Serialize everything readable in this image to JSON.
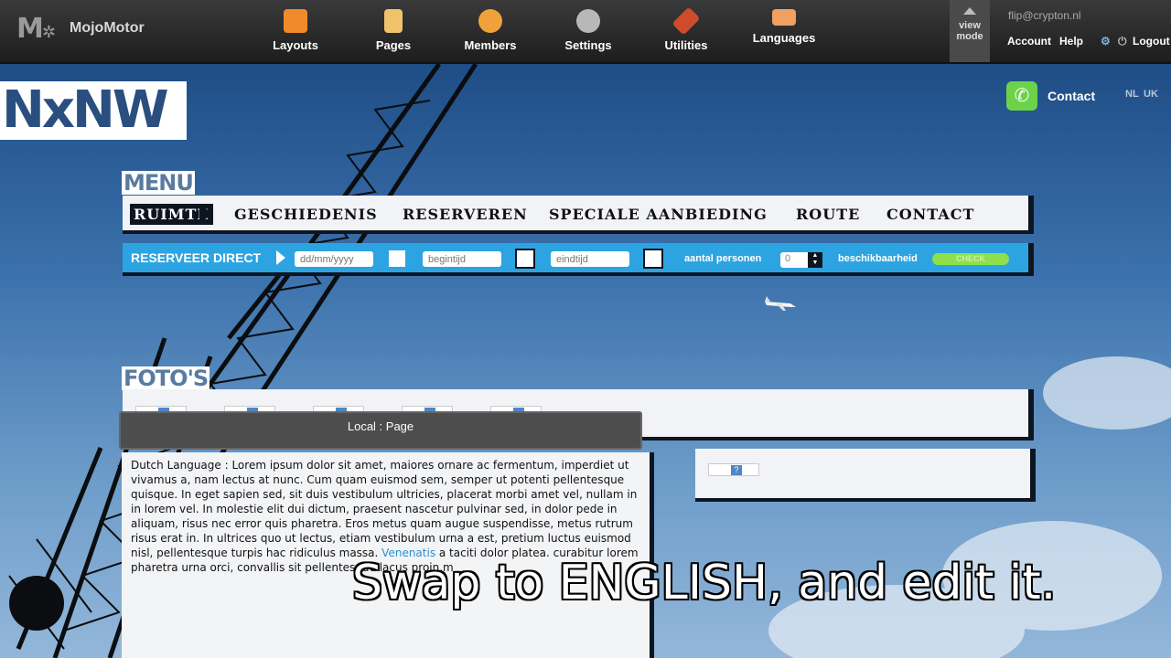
{
  "app": {
    "name": "MojoMotor"
  },
  "toolbar": {
    "nav": [
      {
        "label": "Layouts",
        "icon": "layouts-icon",
        "color": "#f08a2a"
      },
      {
        "label": "Pages",
        "icon": "pages-icon",
        "color": "#f0c36a"
      },
      {
        "label": "Members",
        "icon": "members-icon",
        "color": "#f0a23a"
      },
      {
        "label": "Settings",
        "icon": "settings-icon",
        "color": "#b8b8b8"
      },
      {
        "label": "Utilities",
        "icon": "utilities-icon",
        "color": "#d04b2a"
      },
      {
        "label": "Languages",
        "icon": "languages-icon",
        "color": "#f0a060"
      }
    ],
    "view_mode_line1": "view",
    "view_mode_line2": "mode",
    "user_email": "flip@crypton.nl",
    "account": "Account",
    "help": "Help",
    "logout": "Logout"
  },
  "site": {
    "logo_left": "NxNW",
    "contact": "Contact",
    "lang_nl": "NL",
    "lang_uk": "UK",
    "menu_heading": "MENU",
    "menu": [
      "RUIMTE",
      "GESCHIEDENIS",
      "RESERVEREN",
      "SPECIALE AANBIEDING",
      "ROUTE",
      "CONTACT"
    ],
    "reserve": {
      "title": "RESERVEER DIRECT",
      "date_placeholder": "dd/mm/yyyy",
      "start_placeholder": "begintijd",
      "end_placeholder": "eindtijd",
      "persons_label": "aantal personen",
      "persons_value": "0",
      "availability_label": "beschikbaarheid",
      "check_label": "CHECK"
    },
    "fotos_heading": "FOTO'S",
    "thumb_glyph": "?"
  },
  "editor": {
    "title": "Local : Page",
    "text_before_link": "Dutch Language : Lorem ipsum dolor sit amet, maiores ornare ac fermentum, imperdiet ut vivamus a, nam lectus at nunc. Cum quam euismod sem, semper ut potenti pellentesque quisque. In eget sapien sed, sit duis vestibulum ultricies, placerat morbi amet vel, nullam in in lorem vel. In molestie elit dui dictum, praesent nascetur pulvinar sed, in dolor pede in aliquam, risus nec error quis pharetra. Eros metus quam augue suspendisse, metus rutrum risus erat in.  In ultrices quo ut lectus, etiam vestibulum urna a est, pretium luctus euismod nisl, pellentesque turpis hac ridiculus massa. ",
    "link_text": "Venenatis",
    "text_after_link": " a taciti dolor platea. curabitur lorem pharetra urna orci, convallis sit pellentesque lacus proin.m"
  },
  "caption": "Swap to ENGLISH, and edit it."
}
